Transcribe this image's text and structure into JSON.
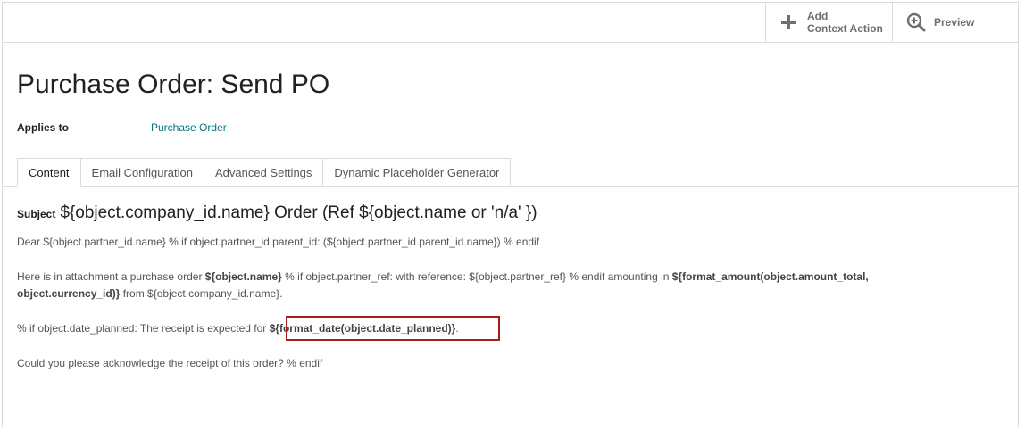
{
  "toolbar": {
    "add_line1": "Add",
    "add_line2": "Context Action",
    "add_icon": "plus-icon",
    "preview_label": "Preview",
    "preview_icon": "zoom-in-icon"
  },
  "form": {
    "title": "Purchase Order: Send PO",
    "applies_to_label": "Applies to",
    "applies_to_value": "Purchase Order"
  },
  "tabs": [
    {
      "label": "Content",
      "active": true
    },
    {
      "label": "Email Configuration",
      "active": false
    },
    {
      "label": "Advanced Settings",
      "active": false
    },
    {
      "label": "Dynamic Placeholder Generator",
      "active": false
    }
  ],
  "content": {
    "subject_label": "Subject",
    "subject_value": "${object.company_id.name} Order (Ref ${object.name or 'n/a' })",
    "line1": "Dear ${object.partner_id.name} % if object.partner_id.parent_id: (${object.partner_id.parent_id.name}) % endif",
    "line2_a": "Here is in attachment a purchase order ",
    "line2_b": "${object.name}",
    "line2_c": " % if object.partner_ref: with reference: ${object.partner_ref} % endif amounting in ",
    "line2_d": "${format_amount(object.amount_total, object.currency_id)}",
    "line2_e": " from ${object.company_id.name}.",
    "line3_a": "% if object.date_planned: The receipt is expected for ",
    "line3_b": "${format_date(object.date_planned)}",
    "line3_c": ".",
    "line4": "Could you please acknowledge the receipt of this order? % endif"
  },
  "colors": {
    "link": "#00767b",
    "highlight_border": "#a52020"
  }
}
